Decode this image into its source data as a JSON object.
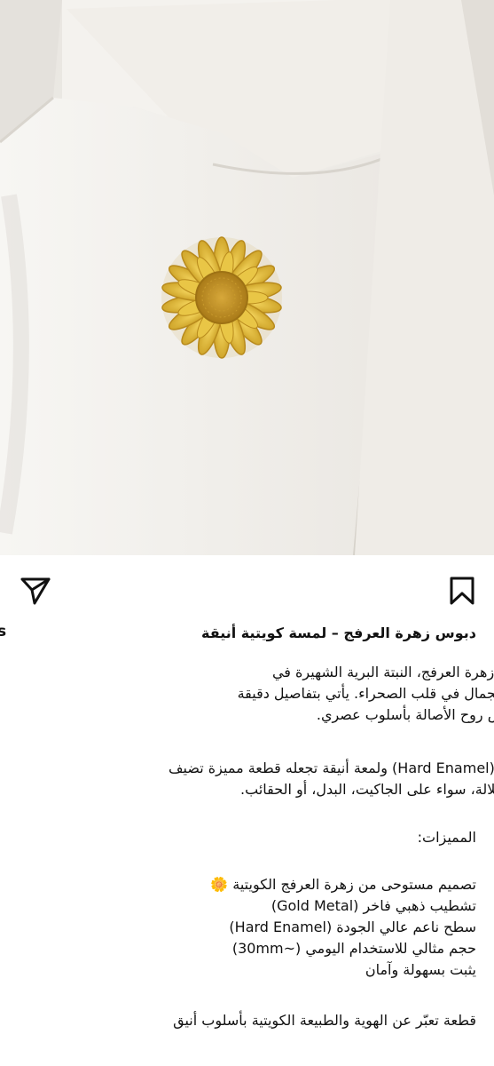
{
  "post": {
    "image": {
      "subject": "sunflower-pin-on-white-jacket",
      "colors": {
        "jacket": "#f2f0ec",
        "pin_gold": "#d4aa2c",
        "pin_center": "#b8871c"
      }
    },
    "actions": {
      "share_icon": "send-icon",
      "save_icon": "bookmark-icon"
    },
    "caption": {
      "account_fragment": "s",
      "title": "دبوس زهرة العرفج – لمسة كويتية أنيقة",
      "paragraph1": [
        "استوحى هذا الدبوس تصميمه من زهرة العرفج، النبتة البرية الشهيرة في",
        "الكويت، والتي ترمز إلى الصبر والجمال في قلب الصحراء. يأتي بتفاصيل دقيقة",
        "وتشطيب معدني ذهبي فاخر يعكس روح الأصالة بأسلوب عصري."
      ],
      "paragraph2": [
        "يتميز بسطح ناعم (Hard Enamel) ولمعة أنيقة تجعله قطعة مميزة تضيف",
        "طابعًا راقيًا لأي إطلالة، سواء على الجاكيت، البدل، أو الحقائب."
      ],
      "features_heading": "المميزات:",
      "features": [
        "تصميم مستوحى من زهرة العرفج الكويتية 🌼",
        "تشطيب ذهبي فاخر (Gold Metal)",
        "سطح ناعم عالي الجودة (Hard Enamel)",
        "حجم مثالي للاستخدام اليومي (~30mm)",
        "يثبت بسهولة وآمان"
      ],
      "closing": "قطعة تعبّر عن الهوية والطبيعة الكويتية بأسلوب أنيق"
    }
  }
}
